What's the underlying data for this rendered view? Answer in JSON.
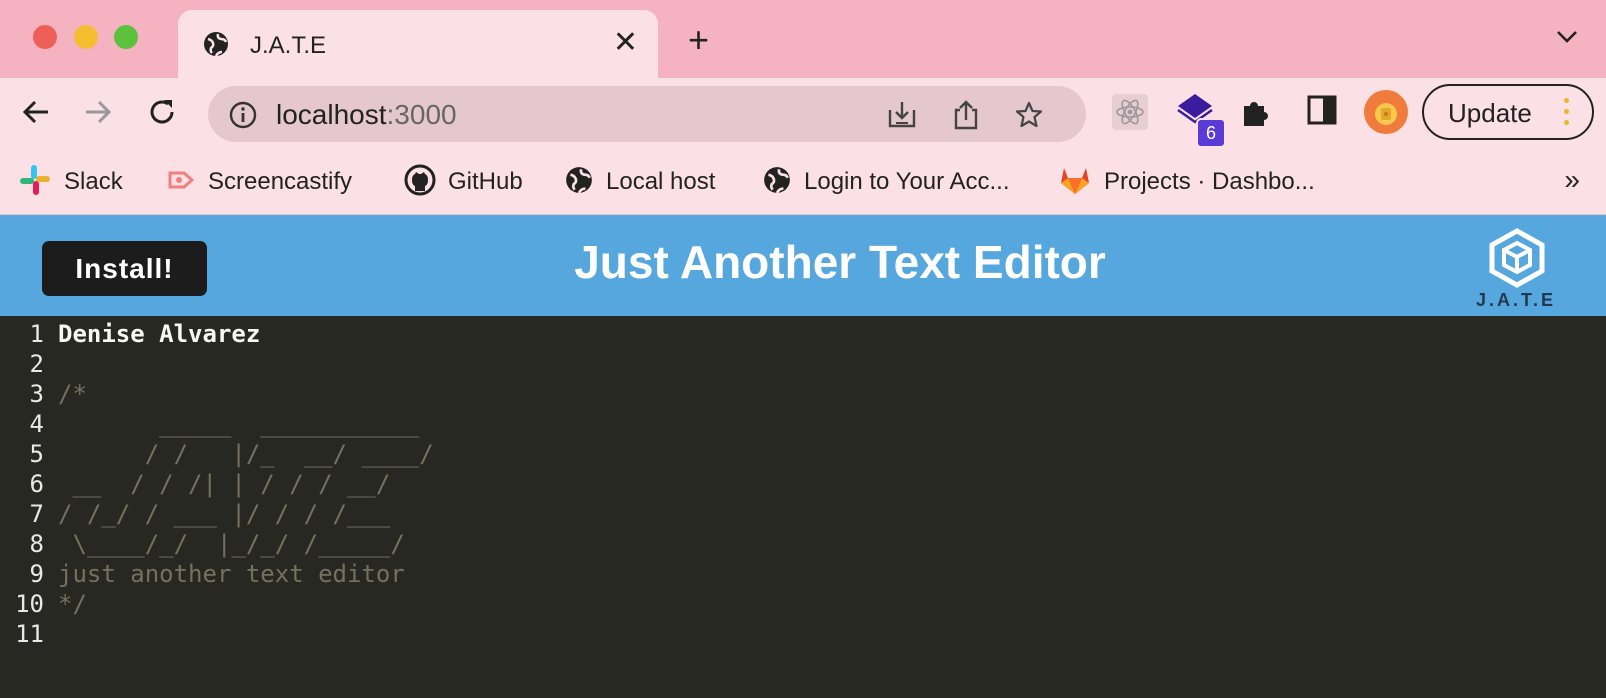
{
  "browser": {
    "tab_title": "J.A.T.E",
    "url_host": "localhost",
    "url_port": ":3000",
    "update_label": "Update",
    "extension_badge": "6",
    "bookmarks": [
      {
        "label": "Slack",
        "icon": "slack-icon"
      },
      {
        "label": "Screencastify",
        "icon": "screencastify-icon"
      },
      {
        "label": "GitHub",
        "icon": "github-icon"
      },
      {
        "label": "Local host",
        "icon": "globe-icon"
      },
      {
        "label": "Login to Your Acc...",
        "icon": "globe-icon"
      },
      {
        "label": "Projects · Dashbo...",
        "icon": "gitlab-icon"
      }
    ],
    "more_bookmarks": "»",
    "colors": {
      "tabstrip": "#f5b3c1",
      "toolbar": "#fbe1e6"
    }
  },
  "app": {
    "install_label": "Install!",
    "title": "Just Another Text Editor",
    "logo_text": "J.A.T.E",
    "header_color": "#57a7df",
    "editor_bg": "#272822"
  },
  "editor": {
    "lines": [
      {
        "n": "1",
        "text": "Denise Alvarez"
      },
      {
        "n": "2",
        "text": ""
      },
      {
        "n": "3",
        "text": "/*"
      },
      {
        "n": "4",
        "text": "       _____  ___________"
      },
      {
        "n": "5",
        "text": "      / /   |/_  __/ ____/"
      },
      {
        "n": "6",
        "text": " __  / / /| | / / / __/"
      },
      {
        "n": "7",
        "text": "/ /_/ / ___ |/ / / /___"
      },
      {
        "n": "8",
        "text": " \\____/_/  |_/_/ /_____/"
      },
      {
        "n": "9",
        "text": "just another text editor"
      },
      {
        "n": "10",
        "text": "*/"
      },
      {
        "n": "11",
        "text": ""
      }
    ]
  }
}
